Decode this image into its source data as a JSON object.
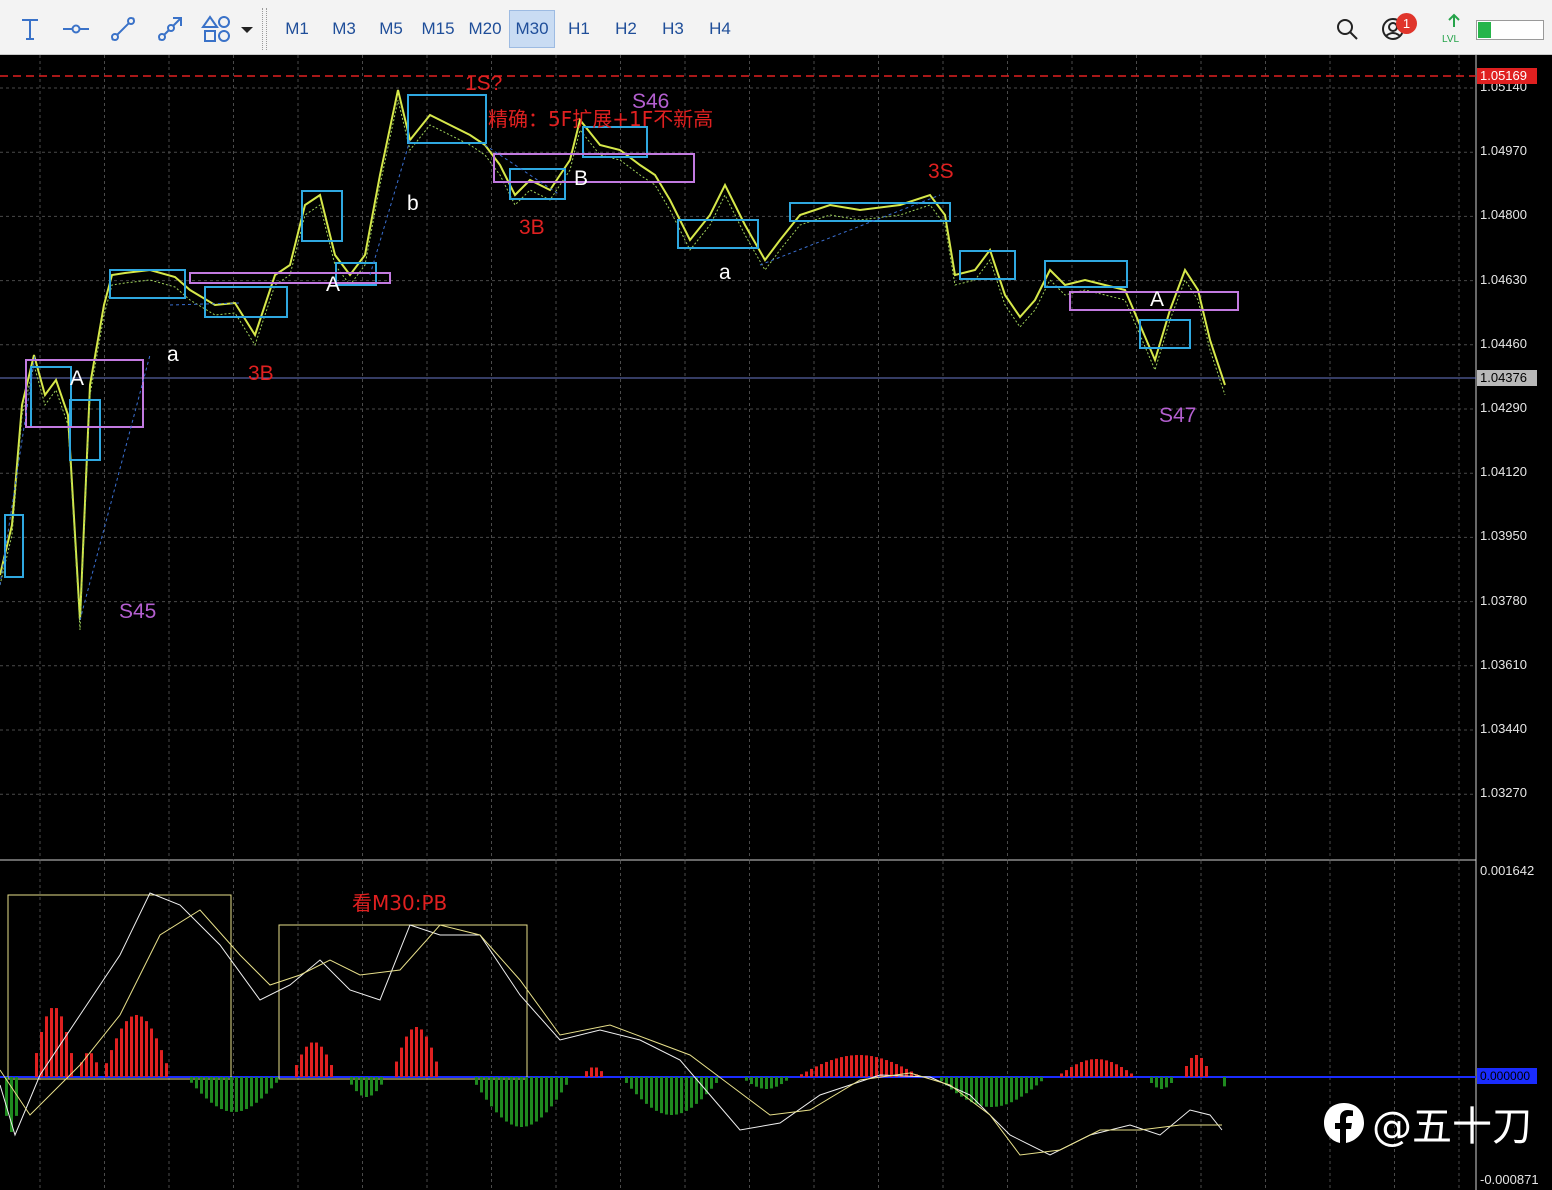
{
  "toolbar": {
    "drawing_tools": [
      {
        "name": "text-tool-icon"
      },
      {
        "name": "horizontal-line-icon"
      },
      {
        "name": "trend-line-icon"
      },
      {
        "name": "arrowed-line-icon"
      },
      {
        "name": "shapes-icon"
      }
    ],
    "timeframes": [
      {
        "label": "M1",
        "active": false
      },
      {
        "label": "M3",
        "active": false
      },
      {
        "label": "M5",
        "active": false
      },
      {
        "label": "M15",
        "active": false
      },
      {
        "label": "M20",
        "active": false
      },
      {
        "label": "M30",
        "active": true
      },
      {
        "label": "H1",
        "active": false
      },
      {
        "label": "H2",
        "active": false
      },
      {
        "label": "H3",
        "active": false
      },
      {
        "label": "H4",
        "active": false
      }
    ],
    "notification_count": "1",
    "lvl_label": "LVL",
    "lvl_level": 0.2
  },
  "main_chart": {
    "price_axis": [
      "1.05140",
      "1.04970",
      "1.04800",
      "1.04630",
      "1.04460",
      "1.04290",
      "1.04120",
      "1.03950",
      "1.03780",
      "1.03610",
      "1.03440",
      "1.03270"
    ],
    "alert_price": "1.05169",
    "current_price": "1.04376",
    "annotations": [
      {
        "text": "1S?",
        "color": "#e02020"
      },
      {
        "text": "精确：5F扩展+1F不新高",
        "color": "#e02020"
      },
      {
        "text": "S46",
        "color": "#b45fd0"
      },
      {
        "text": "3S",
        "color": "#e02020"
      },
      {
        "text": "b",
        "color": "#ffffff"
      },
      {
        "text": "3B",
        "color": "#e02020"
      },
      {
        "text": "B",
        "color": "#ffffff"
      },
      {
        "text": "A",
        "color": "#ffffff"
      },
      {
        "text": "a",
        "color": "#ffffff"
      },
      {
        "text": "A",
        "color": "#ffffff"
      },
      {
        "text": "a",
        "color": "#ffffff"
      },
      {
        "text": "3B",
        "color": "#e02020"
      },
      {
        "text": "A",
        "color": "#ffffff"
      },
      {
        "text": "S47",
        "color": "#b45fd0"
      },
      {
        "text": "S45",
        "color": "#b45fd0"
      }
    ]
  },
  "indicator": {
    "axis_top": "0.001642",
    "axis_bottom": "-0.000871",
    "zero_tag": "0.000000",
    "annotation": {
      "text": "看M30:PB",
      "color": "#e02020"
    }
  },
  "watermark": {
    "text": "@五十刀"
  },
  "colors": {
    "background": "#000000",
    "grid": "#4a4a4a",
    "price_line": "#d6e84a",
    "box_blue": "#2fa8e0",
    "box_purple": "#c27ae0",
    "alert_line": "#e02020",
    "hist_positive": "#e02020",
    "hist_negative": "#1f8a1f",
    "zero_line": "#1a2cff"
  }
}
